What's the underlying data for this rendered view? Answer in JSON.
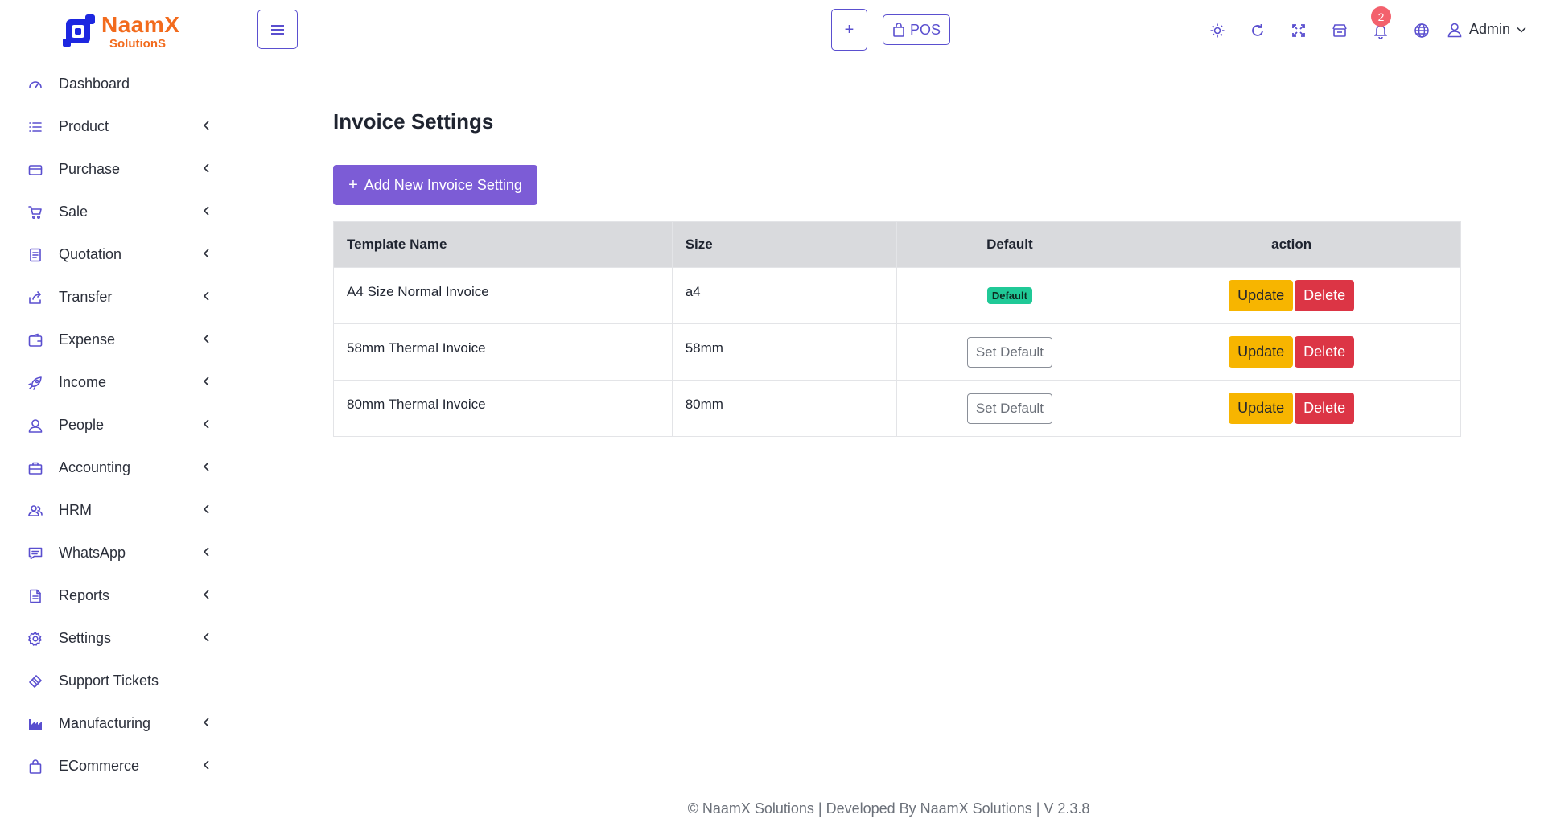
{
  "brand": {
    "name": "NaamX",
    "sub": "SolutionS",
    "primary": "#5a4fcf",
    "accent": "#f26b1d"
  },
  "sidebar": {
    "items": [
      {
        "label": "Dashboard",
        "icon": "gauge-icon",
        "chevron": false
      },
      {
        "label": "Product",
        "icon": "list-icon",
        "chevron": true
      },
      {
        "label": "Purchase",
        "icon": "card-icon",
        "chevron": true
      },
      {
        "label": "Sale",
        "icon": "cart-icon",
        "chevron": true
      },
      {
        "label": "Quotation",
        "icon": "document-icon",
        "chevron": true
      },
      {
        "label": "Transfer",
        "icon": "share-icon",
        "chevron": true
      },
      {
        "label": "Expense",
        "icon": "wallet-icon",
        "chevron": true
      },
      {
        "label": "Income",
        "icon": "rocket-icon",
        "chevron": true
      },
      {
        "label": "People",
        "icon": "user-icon",
        "chevron": true
      },
      {
        "label": "Accounting",
        "icon": "briefcase-icon",
        "chevron": true
      },
      {
        "label": "HRM",
        "icon": "users-icon",
        "chevron": true
      },
      {
        "label": "WhatsApp",
        "icon": "chat-icon",
        "chevron": true
      },
      {
        "label": "Reports",
        "icon": "file-icon",
        "chevron": true
      },
      {
        "label": "Settings",
        "icon": "gear-icon",
        "chevron": true
      },
      {
        "label": "Support Tickets",
        "icon": "ticket-icon",
        "chevron": false
      },
      {
        "label": "Manufacturing",
        "icon": "factory-icon",
        "chevron": true
      },
      {
        "label": "ECommerce",
        "icon": "bag-icon",
        "chevron": true
      }
    ]
  },
  "topbar": {
    "pos_label": "POS",
    "notification_count": "2",
    "user_name": "Admin"
  },
  "main": {
    "title": "Invoice Settings",
    "add_button": "Add New Invoice Setting",
    "table": {
      "headers": [
        "Template Name",
        "Size",
        "Default",
        "action"
      ],
      "default_badge": "Default",
      "set_default_label": "Set Default",
      "update_label": "Update",
      "delete_label": "Delete",
      "rows": [
        {
          "name": "A4 Size Normal Invoice",
          "size": "a4",
          "is_default": true
        },
        {
          "name": "58mm Thermal Invoice",
          "size": "58mm",
          "is_default": false
        },
        {
          "name": "80mm Thermal Invoice",
          "size": "80mm",
          "is_default": false
        }
      ]
    }
  },
  "footer": {
    "text": "© NaamX Solutions | Developed By NaamX Solutions | V 2.3.8"
  }
}
